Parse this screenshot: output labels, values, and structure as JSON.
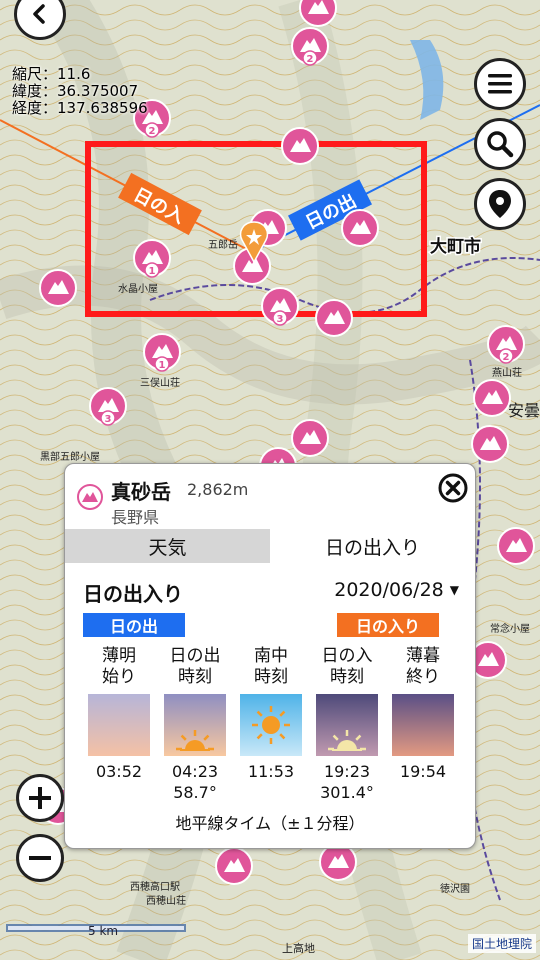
{
  "map": {
    "scale_line": "縮尺：11.6",
    "lat_line": "緯度：36.375007",
    "lon_line": "経度：137.638596",
    "sunset_label": "日の入",
    "sunrise_label": "日の出",
    "city_label": "大町市",
    "place_labels": [
      "五郎岳",
      "水晶小屋",
      "三俣山荘",
      "黒部五郎小屋",
      "常念小屋",
      "燕山荘",
      "安曇",
      "西穂高口駅",
      "西穂山荘",
      "上高地",
      "徳沢園"
    ],
    "scale_bar": "5 km",
    "attribution": "国土地理院"
  },
  "controls": {
    "back_icon": "chevron-left-icon",
    "menu_icon": "hamburger-menu-icon",
    "search_icon": "search-icon",
    "location_icon": "location-pin-icon",
    "zoom_in_icon": "plus-icon",
    "zoom_out_icon": "minus-icon"
  },
  "panel": {
    "peak_name": "真砂岳",
    "elevation": "2,862m",
    "prefecture": "長野県",
    "tabs": [
      {
        "label": "天気",
        "active": false
      },
      {
        "label": "日の出入り",
        "active": true
      }
    ],
    "section_title": "日の出入り",
    "date": "2020/06/28",
    "sunrise_badge": "日の出",
    "sunset_badge": "日の入り",
    "columns": [
      {
        "label1": "薄明",
        "label2": "始り",
        "time": "03:52",
        "azimuth": ""
      },
      {
        "label1": "日の出",
        "label2": "時刻",
        "time": "04:23",
        "azimuth": "58.7°"
      },
      {
        "label1": "南中",
        "label2": "時刻",
        "time": "11:53",
        "azimuth": ""
      },
      {
        "label1": "日の入",
        "label2": "時刻",
        "time": "19:23",
        "azimuth": "301.4°"
      },
      {
        "label1": "薄暮",
        "label2": "終り",
        "time": "19:54",
        "azimuth": ""
      }
    ],
    "footnote": "地平線タイム（±１分程）"
  },
  "colors": {
    "accent_blue": "#1e6ef0",
    "accent_orange": "#f37021",
    "marker_pink": "#e0559a",
    "highlight_red": "#ff1a1a"
  }
}
